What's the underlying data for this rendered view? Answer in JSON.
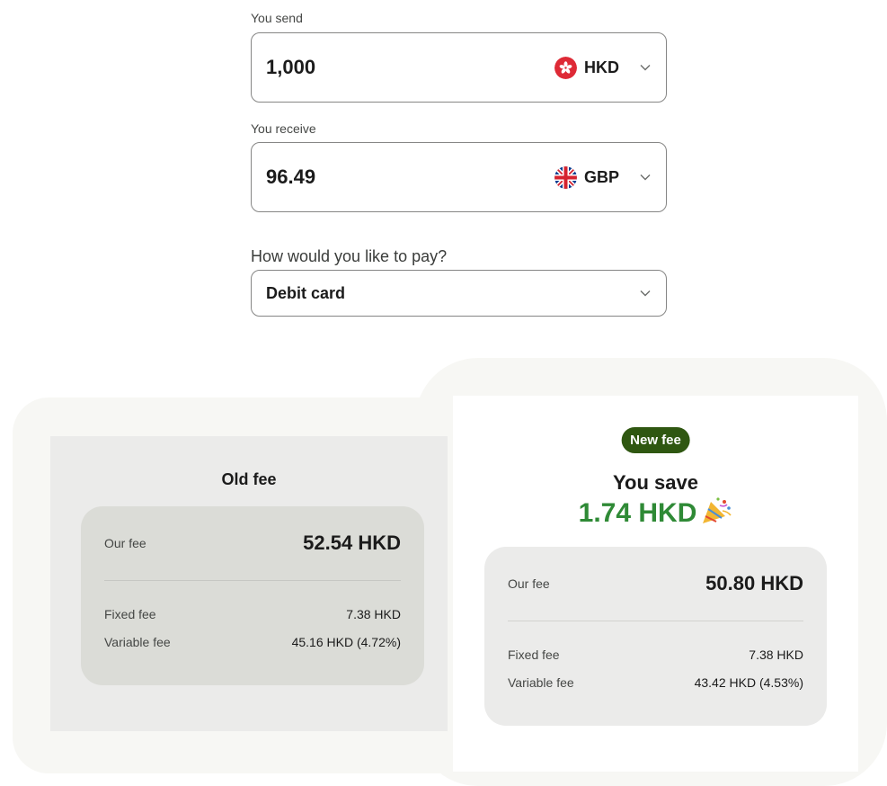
{
  "send": {
    "label": "You send",
    "amount": "1,000",
    "currency": "HKD",
    "flag_icon": "hong-kong-flag-icon"
  },
  "receive": {
    "label": "You receive",
    "amount": "96.49",
    "currency": "GBP",
    "flag_icon": "uk-flag-icon"
  },
  "payment": {
    "label": "How would you like to pay?",
    "selected": "Debit card"
  },
  "old_fee": {
    "title": "Old fee",
    "our_fee_label": "Our fee",
    "our_fee_value": "52.54 HKD",
    "fixed_fee_label": "Fixed fee",
    "fixed_fee_value": "7.38 HKD",
    "variable_fee_label": "Variable fee",
    "variable_fee_value": "45.16 HKD (4.72%)"
  },
  "new_fee": {
    "badge": "New fee",
    "you_save_label": "You save",
    "saving_amount": "1.74 HKD",
    "our_fee_label": "Our fee",
    "our_fee_value": "50.80 HKD",
    "fixed_fee_label": "Fixed fee",
    "fixed_fee_value": "7.38 HKD",
    "variable_fee_label": "Variable fee",
    "variable_fee_value": "43.42 HKD (4.53%)"
  },
  "colors": {
    "badge_bg": "#2f5711",
    "saving_green": "#2f8a36",
    "hkd_flag_red": "#de2a36",
    "gbp_flag_blue": "#0a3b8f"
  }
}
